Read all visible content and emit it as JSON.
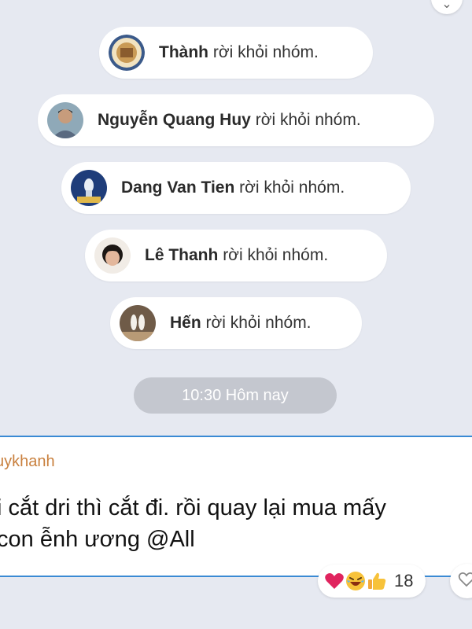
{
  "system_notices": [
    {
      "name": "Thành",
      "action": "rời khỏi nhóm."
    },
    {
      "name": "Nguyễn Quang Huy",
      "action": "rời khỏi nhóm."
    },
    {
      "name": "Dang Van Tien",
      "action": "rời khỏi nhóm."
    },
    {
      "name": "Lê Thanh",
      "action": "rời khỏi nhóm."
    },
    {
      "name": "Hến",
      "action": "rời khỏi nhóm."
    }
  ],
  "timestamp": "10:30 Hôm nay",
  "message": {
    "sender": "Duykhanh",
    "sender_visible": "uykhanh",
    "line1": "i cắt dri thì cắt đi. rồi quay lại mua mấy",
    "line2": "con ễnh ương @All",
    "reactions": [
      "heart-icon",
      "laughing-face-icon",
      "thumbs-up-icon"
    ],
    "reaction_count": "18"
  },
  "colors": {
    "background": "#e6e9f1",
    "sender_name": "#c9803e",
    "highlight_border": "#3a8ad4",
    "timestamp_pill": "#c4c7cf"
  }
}
